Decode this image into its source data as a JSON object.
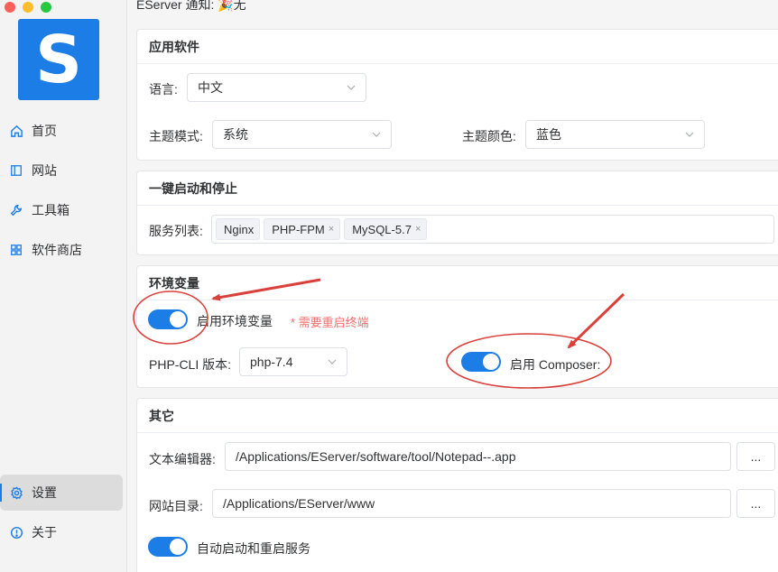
{
  "window": {
    "traffic_colors": [
      "#fe5f57",
      "#febc2e",
      "#28c840"
    ]
  },
  "sidebar": {
    "logo_letter": "S",
    "items": [
      {
        "label": "首页",
        "icon": "home-icon"
      },
      {
        "label": "网站",
        "icon": "website-icon"
      },
      {
        "label": "工具箱",
        "icon": "wrench-icon"
      },
      {
        "label": "软件商店",
        "icon": "store-icon"
      }
    ],
    "bottom_items": [
      {
        "label": "设置",
        "icon": "gear-icon",
        "active": true
      },
      {
        "label": "关于",
        "icon": "info-icon"
      }
    ]
  },
  "notice": {
    "text": "EServer 通知: 🎉无"
  },
  "app_settings": {
    "title": "应用软件",
    "language_label": "语言:",
    "language_value": "中文",
    "theme_mode_label": "主题模式:",
    "theme_mode_value": "系统",
    "theme_color_label": "主题颜色:",
    "theme_color_value": "蓝色"
  },
  "one_click": {
    "title": "一键启动和停止",
    "service_list_label": "服务列表:",
    "services": [
      {
        "name": "Nginx",
        "closable": false
      },
      {
        "name": "PHP-FPM",
        "closable": true
      },
      {
        "name": "MySQL-5.7",
        "closable": true
      }
    ],
    "close_glyph": "×"
  },
  "env": {
    "title": "环境变量",
    "enable_env_label": "启用环境变量",
    "enable_env_on": true,
    "restart_note": "* 需要重启终端",
    "php_cli_label": "PHP-CLI 版本:",
    "php_cli_value": "php-7.4",
    "composer_label": "启用 Composer:",
    "composer_on": true
  },
  "other": {
    "title": "其它",
    "editor_label": "文本编辑器:",
    "editor_path": "/Applications/EServer/software/tool/Notepad--.app",
    "browse_label": "...",
    "site_dir_label": "网站目录:",
    "site_dir_path": "/Applications/EServer/www",
    "autostart_label": "自动启动和重启服务",
    "autostart_on": true
  },
  "colors": {
    "accent": "#1c7de6",
    "annotation_red": "#d9413a",
    "warning": "#f56c6c"
  }
}
